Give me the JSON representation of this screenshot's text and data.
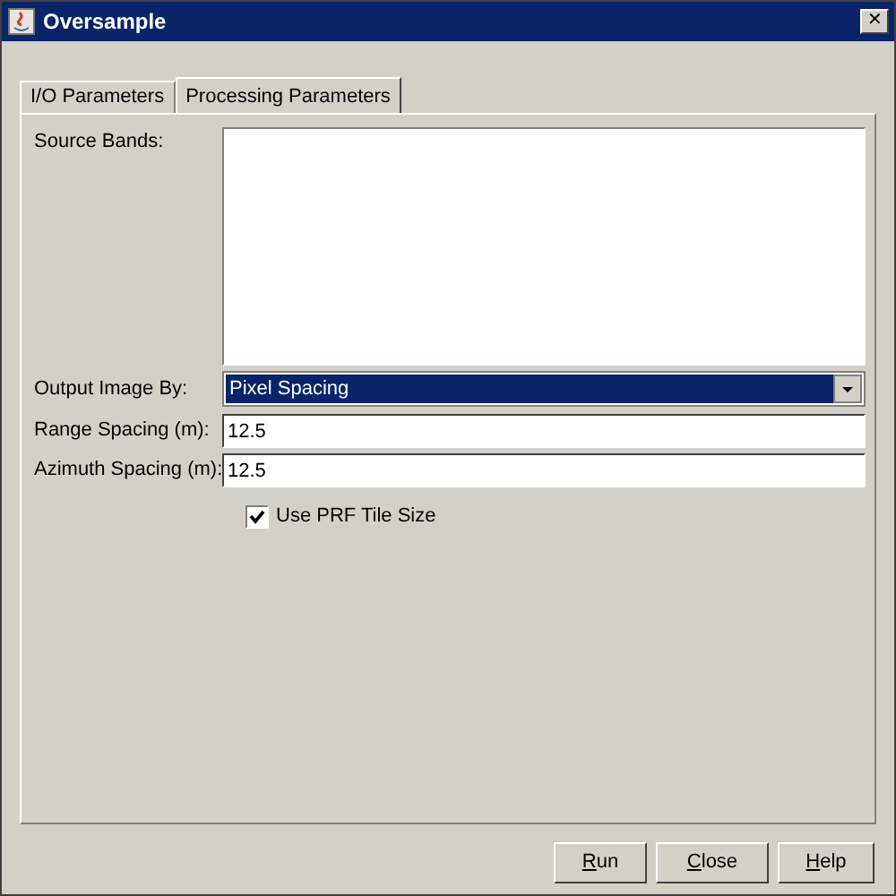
{
  "window": {
    "title": "Oversample",
    "close_button": "✕"
  },
  "tabs": [
    {
      "label": "I/O Parameters",
      "selected": false
    },
    {
      "label": "Processing Parameters",
      "selected": true
    }
  ],
  "form": {
    "source_bands_label": "Source Bands:",
    "output_image_by": {
      "label": "Output Image By:",
      "value": "Pixel Spacing"
    },
    "range_spacing": {
      "label": "Range Spacing (m):",
      "value": "12.5"
    },
    "azimuth_spacing": {
      "label": "Azimuth Spacing (m):",
      "value": "12.5"
    },
    "use_prf_tile_size": {
      "label": "Use PRF Tile Size",
      "checked": true
    }
  },
  "buttons": [
    {
      "label": "Run",
      "underline_first": true
    },
    {
      "label": "Close",
      "underline_first": true
    },
    {
      "label": "Help",
      "underline_first": true
    }
  ]
}
